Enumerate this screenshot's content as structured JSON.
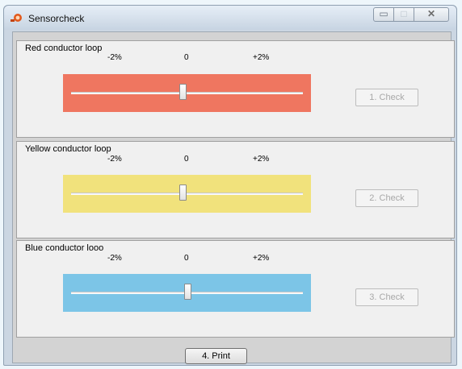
{
  "window": {
    "title": "Sensorcheck",
    "controls": {
      "minimize_icon": "minimize-icon",
      "maximize_icon": "maximize-icon",
      "close_icon": "close-icon"
    }
  },
  "panels": [
    {
      "title": "Red conductor loop",
      "tick_min": "-2%",
      "tick_mid": "0",
      "tick_max": "+2%",
      "slider_value_fraction": 0.48,
      "check_label": "1. Check",
      "check_enabled": false,
      "color": "#ef7660"
    },
    {
      "title": "Yellow conductor loop",
      "tick_min": "-2%",
      "tick_mid": "0",
      "tick_max": "+2%",
      "slider_value_fraction": 0.48,
      "check_label": "2. Check",
      "check_enabled": false,
      "color": "#f1e27c"
    },
    {
      "title": "Blue conductor looo",
      "tick_min": "-2%",
      "tick_mid": "0",
      "tick_max": "+2%",
      "slider_value_fraction": 0.5,
      "check_label": "3. Check",
      "check_enabled": false,
      "color": "#7cc5e7"
    }
  ],
  "footer": {
    "print_label": "4. Print"
  }
}
